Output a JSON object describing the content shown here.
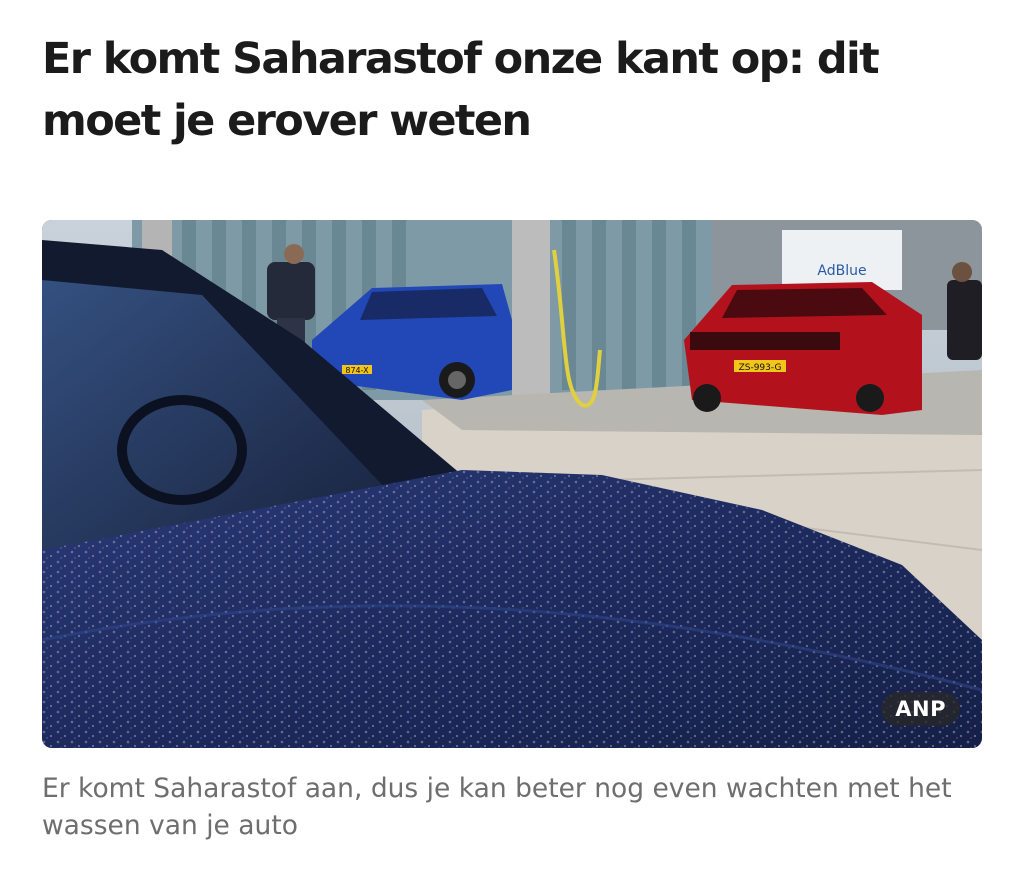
{
  "article": {
    "headline": "Er komt Saharastof onze kant op: dit moet je erover weten",
    "image": {
      "credit": "ANP",
      "sign_text": "AdBlue",
      "plate_blue_car": "874-X",
      "plate_red_car": "ZS-993-G"
    },
    "caption": "Er komt Saharastof aan, dus je kan beter nog even wachten met het wassen van je auto"
  }
}
